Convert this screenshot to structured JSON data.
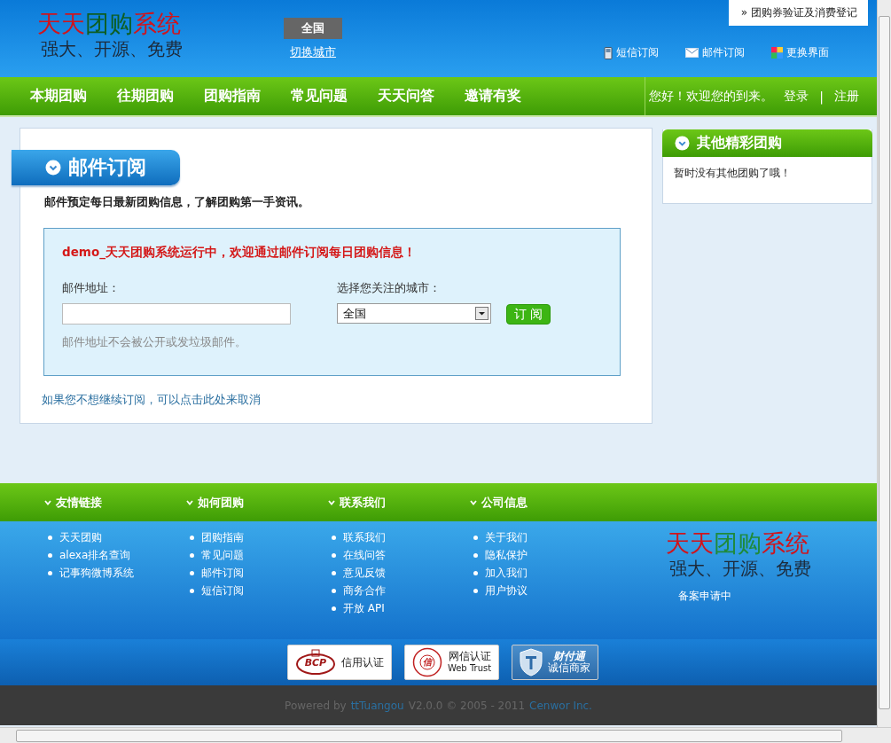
{
  "header": {
    "logo": {
      "title_parts": [
        {
          "text": "天天",
          "color": "#d0141c"
        },
        {
          "text": "团购",
          "color": "#0d5e22"
        },
        {
          "text": "系统",
          "color": "#d0141c"
        }
      ],
      "slogan": "强大、开源、免费"
    },
    "city": {
      "current": "全国",
      "switch_link": "切换城市"
    },
    "top_link": "团购券验证及消费登记",
    "top_link_mark": "»",
    "tools": [
      {
        "kind": "phone",
        "label": "短信订阅"
      },
      {
        "kind": "mail",
        "label": "邮件订阅"
      },
      {
        "kind": "palette",
        "label": "更换界面"
      }
    ]
  },
  "nav": {
    "items": [
      "本期团购",
      "往期团购",
      "团购指南",
      "常见问题",
      "天天问答",
      "邀请有奖"
    ],
    "greeting": "您好！欢迎您的到来。",
    "login": "登录",
    "separator": "|",
    "register": "注册"
  },
  "main": {
    "title": "邮件订阅",
    "intro": "邮件预定每日最新团购信息，了解团购第一手资讯。",
    "form": {
      "notice": "demo_天天团购系统运行中，欢迎通过邮件订阅每日团购信息！",
      "email_label": "邮件地址：",
      "email_hint": "邮件地址不会被公开或发垃圾邮件。",
      "city_label": "选择您关注的城市：",
      "city_value": "全国",
      "submit": "订 阅"
    },
    "cancel_link": "如果您不想继续订阅，可以点击此处来取消"
  },
  "sidebar": {
    "title": "其他精彩团购",
    "empty_text": "暂时没有其他团购了哦！"
  },
  "footer": {
    "columns": [
      {
        "title": "友情链接",
        "links": [
          "天天团购",
          "alexa排名查询",
          "记事狗微博系统"
        ]
      },
      {
        "title": "如何团购",
        "links": [
          "团购指南",
          "常见问题",
          "邮件订阅",
          "短信订阅"
        ]
      },
      {
        "title": "联系我们",
        "links": [
          "联系我们",
          "在线问答",
          "意见反馈",
          "商务合作",
          "开放 API"
        ]
      },
      {
        "title": "公司信息",
        "links": [
          "关于我们",
          "隐私保护",
          "加入我们",
          "用户协议"
        ]
      }
    ],
    "logo": {
      "title_parts": [
        {
          "text": "天天",
          "color": "#d0141c"
        },
        {
          "text": "团购",
          "color": "#1f8a3a"
        },
        {
          "text": "系统",
          "color": "#d0141c"
        }
      ],
      "slogan": "强大、开源、免费"
    },
    "record": "备案申请中",
    "badges": [
      {
        "kind": "bcp",
        "mark": "BCP",
        "lines": [
          "信用认证"
        ]
      },
      {
        "kind": "seal",
        "mark": "信",
        "lines": [
          "网信认证",
          "Web Trust"
        ]
      },
      {
        "kind": "shield",
        "mark": "财付通",
        "lines": [
          "诚信商家"
        ]
      }
    ],
    "powered_prefix": "Powered by",
    "powered_brand": "ttTuangou",
    "powered_middle": "V2.0.0 © 2005 - 2011",
    "powered_company": "Cenwor Inc."
  }
}
